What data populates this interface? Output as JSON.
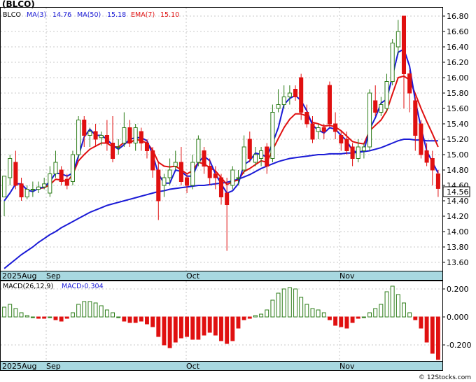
{
  "title": "(BLCO)",
  "legend": {
    "ticker": "BLCO",
    "ma3_label": "MA(3)",
    "ma3_value": "14.76",
    "ma50_label": "MA(50)",
    "ma50_value": "15.18",
    "ema7_label": "EMA(7)",
    "ema7_value": "15.10"
  },
  "macd_legend": {
    "label": "MACD(26,12,9)",
    "macd_label": "MACD:",
    "macd_value": "-0.304"
  },
  "last_price_tag": "14.56",
  "watermark": "© 12Stocks.com",
  "colors": {
    "up": "#2e7d1a",
    "down": "#e01010",
    "ma_blue": "#1a1ad6",
    "ema_red": "#e01010",
    "axis_band": "#a8d8e0",
    "grid": "#b8b8b8"
  },
  "chart_data": [
    {
      "type": "candlestick",
      "title": "(BLCO)",
      "x_tick_labels": [
        "2025Aug",
        "Sep",
        "Oct",
        "Nov"
      ],
      "y_tick_labels": [
        "13.60",
        "13.80",
        "14.00",
        "14.20",
        "14.40",
        "14.60",
        "14.80",
        "15.00",
        "15.20",
        "15.40",
        "15.60",
        "15.80",
        "16.00",
        "16.20",
        "16.40",
        "16.60",
        "16.80"
      ],
      "ylim": [
        13.5,
        16.9
      ],
      "grid": true,
      "candles": [
        [
          14.45,
          14.72,
          14.4,
          14.2
        ],
        [
          14.7,
          14.95,
          15.0,
          14.6
        ],
        [
          14.9,
          14.6,
          15.05,
          14.55
        ],
        [
          14.62,
          14.45,
          14.7,
          14.4
        ],
        [
          14.45,
          14.55,
          14.6,
          14.42
        ],
        [
          14.55,
          14.55,
          14.65,
          14.45
        ],
        [
          14.55,
          14.58,
          14.65,
          14.5
        ],
        [
          14.58,
          14.62,
          14.7,
          14.55
        ],
        [
          14.5,
          14.75,
          14.85,
          14.45
        ],
        [
          14.75,
          14.9,
          15.05,
          14.7
        ],
        [
          14.8,
          14.65,
          14.85,
          14.6
        ],
        [
          14.68,
          14.6,
          14.75,
          14.55
        ],
        [
          14.65,
          15.0,
          15.05,
          14.6
        ],
        [
          15.0,
          15.45,
          15.5,
          14.95
        ],
        [
          15.45,
          15.25,
          15.5,
          15.1
        ],
        [
          15.25,
          15.3,
          15.35,
          15.1
        ],
        [
          15.3,
          15.2,
          15.4,
          15.1
        ],
        [
          15.22,
          15.25,
          15.3,
          15.12
        ],
        [
          15.25,
          15.15,
          15.45,
          15.05
        ],
        [
          15.15,
          14.95,
          15.5,
          14.9
        ],
        [
          15.1,
          15.1,
          15.2,
          15.0
        ],
        [
          15.15,
          15.35,
          15.55,
          15.1
        ],
        [
          15.35,
          15.15,
          15.45,
          15.1
        ],
        [
          15.15,
          15.35,
          15.4,
          15.05
        ],
        [
          15.3,
          15.15,
          15.35,
          15.05
        ],
        [
          15.15,
          15.05,
          15.2,
          14.95
        ],
        [
          15.05,
          14.8,
          15.1,
          14.7
        ],
        [
          14.8,
          14.4,
          14.9,
          14.15
        ],
        [
          14.6,
          14.7,
          14.75,
          14.45
        ],
        [
          14.7,
          14.8,
          14.95,
          14.6
        ],
        [
          14.85,
          14.9,
          15.05,
          14.8
        ],
        [
          14.9,
          14.65,
          15.1,
          14.6
        ],
        [
          14.7,
          14.6,
          14.75,
          14.5
        ],
        [
          14.6,
          14.9,
          15.0,
          14.55
        ],
        [
          14.9,
          15.2,
          15.25,
          14.85
        ],
        [
          15.05,
          14.85,
          15.1,
          14.75
        ],
        [
          14.85,
          14.7,
          14.95,
          14.6
        ],
        [
          14.75,
          14.7,
          14.85,
          14.55
        ],
        [
          14.7,
          14.45,
          14.75,
          14.35
        ],
        [
          14.5,
          14.35,
          14.7,
          13.75
        ],
        [
          14.6,
          14.8,
          14.85,
          14.55
        ],
        [
          14.7,
          14.7,
          14.8,
          14.6
        ],
        [
          14.8,
          15.1,
          15.25,
          14.75
        ],
        [
          15.2,
          14.95,
          15.3,
          14.9
        ],
        [
          14.9,
          15.0,
          15.1,
          14.85
        ],
        [
          14.95,
          15.05,
          15.1,
          14.85
        ],
        [
          15.1,
          14.85,
          15.15,
          14.75
        ],
        [
          14.95,
          15.55,
          15.65,
          14.9
        ],
        [
          15.6,
          15.65,
          15.85,
          15.55
        ],
        [
          15.65,
          15.75,
          15.9,
          15.6
        ],
        [
          15.75,
          15.8,
          15.9,
          15.65
        ],
        [
          15.85,
          15.75,
          15.9,
          15.7
        ],
        [
          16.0,
          15.55,
          16.05,
          15.45
        ],
        [
          15.55,
          15.4,
          15.65,
          15.35
        ],
        [
          15.4,
          15.2,
          15.5,
          15.15
        ],
        [
          15.3,
          15.35,
          15.4,
          15.2
        ],
        [
          15.35,
          15.3,
          15.4,
          15.2
        ],
        [
          15.9,
          15.4,
          15.95,
          15.35
        ],
        [
          15.4,
          15.3,
          15.55,
          15.2
        ],
        [
          15.25,
          15.15,
          15.3,
          15.05
        ],
        [
          15.2,
          15.05,
          15.3,
          15.0
        ],
        [
          15.1,
          14.95,
          15.15,
          14.85
        ],
        [
          14.95,
          15.1,
          15.2,
          14.9
        ],
        [
          15.05,
          15.1,
          15.15,
          14.95
        ],
        [
          15.1,
          15.8,
          15.85,
          15.05
        ],
        [
          15.7,
          15.55,
          15.9,
          15.5
        ],
        [
          15.55,
          15.65,
          15.75,
          15.5
        ],
        [
          15.6,
          15.95,
          16.05,
          15.55
        ],
        [
          15.95,
          16.45,
          16.5,
          15.9
        ],
        [
          16.4,
          16.6,
          16.75,
          16.3
        ],
        [
          16.8,
          16.05,
          16.8,
          15.6
        ],
        [
          16.05,
          15.8,
          16.1,
          15.55
        ],
        [
          15.7,
          15.25,
          15.75,
          15.05
        ],
        [
          15.4,
          15.0,
          15.45,
          14.95
        ],
        [
          15.05,
          14.9,
          15.15,
          14.85
        ],
        [
          14.95,
          14.8,
          15.05,
          14.6
        ],
        [
          14.75,
          14.56,
          14.8,
          14.45
        ]
      ],
      "ma3": [
        14.4,
        14.5,
        14.62,
        14.62,
        14.54,
        14.52,
        14.56,
        14.58,
        14.65,
        14.76,
        14.75,
        14.72,
        14.76,
        14.98,
        15.23,
        15.33,
        15.25,
        15.25,
        15.2,
        15.12,
        15.07,
        15.13,
        15.2,
        15.22,
        15.22,
        15.18,
        15.0,
        14.75,
        14.63,
        14.63,
        14.8,
        14.78,
        14.72,
        14.72,
        14.9,
        14.98,
        14.92,
        14.75,
        14.62,
        14.5,
        14.53,
        14.62,
        14.87,
        14.92,
        15.02,
        15.0,
        14.97,
        15.15,
        15.35,
        15.65,
        15.73,
        15.77,
        15.7,
        15.57,
        15.38,
        15.32,
        15.28,
        15.35,
        15.33,
        15.25,
        15.18,
        15.05,
        15.03,
        15.05,
        15.33,
        15.48,
        15.67,
        15.72,
        16.02,
        16.33,
        16.37,
        16.15,
        15.7,
        15.35,
        15.05,
        14.9,
        14.76
      ],
      "ema7": [
        null,
        null,
        null,
        null,
        null,
        null,
        14.56,
        14.57,
        14.61,
        14.68,
        14.67,
        14.65,
        14.74,
        14.92,
        15.0,
        15.07,
        15.11,
        15.15,
        15.15,
        15.1,
        15.1,
        15.16,
        15.15,
        15.2,
        15.18,
        15.15,
        15.06,
        14.9,
        14.85,
        14.84,
        14.85,
        14.8,
        14.75,
        14.79,
        14.9,
        14.88,
        14.83,
        14.79,
        14.7,
        14.61,
        14.65,
        14.67,
        14.78,
        14.82,
        14.87,
        14.92,
        14.9,
        15.06,
        15.21,
        15.35,
        15.46,
        15.53,
        15.53,
        15.5,
        15.42,
        15.4,
        15.37,
        15.38,
        15.36,
        15.31,
        15.24,
        15.17,
        15.15,
        15.14,
        15.31,
        15.38,
        15.45,
        15.57,
        15.79,
        16.0,
        16.02,
        15.97,
        15.79,
        15.6,
        15.43,
        15.27,
        15.1
      ],
      "ma50": [
        13.52,
        13.58,
        13.64,
        13.7,
        13.75,
        13.8,
        13.86,
        13.91,
        13.96,
        14.0,
        14.05,
        14.09,
        14.13,
        14.17,
        14.21,
        14.25,
        14.28,
        14.31,
        14.34,
        14.36,
        14.38,
        14.4,
        14.42,
        14.44,
        14.46,
        14.48,
        14.5,
        14.52,
        14.53,
        14.55,
        14.56,
        14.57,
        14.58,
        14.59,
        14.6,
        14.6,
        14.61,
        14.62,
        14.63,
        14.64,
        14.66,
        14.68,
        14.71,
        14.74,
        14.78,
        14.82,
        14.85,
        14.88,
        14.91,
        14.93,
        14.95,
        14.96,
        14.97,
        14.98,
        14.99,
        15.0,
        15.0,
        15.01,
        15.01,
        15.01,
        15.02,
        15.02,
        15.03,
        15.04,
        15.05,
        15.07,
        15.09,
        15.12,
        15.15,
        15.18,
        15.2,
        15.2,
        15.19,
        15.19,
        15.18,
        15.18,
        15.18
      ]
    },
    {
      "type": "bar",
      "title": "MACD(26,12,9)",
      "x_tick_labels": [
        "2025Aug",
        "Sep",
        "Oct",
        "Nov"
      ],
      "y_tick_labels": [
        "0.200",
        "0.000",
        "-0.200"
      ],
      "ylim": [
        -0.31,
        0.25
      ],
      "grid": true,
      "values": [
        0.07,
        0.09,
        0.06,
        0.03,
        0.01,
        0.0,
        -0.01,
        -0.01,
        0.0,
        -0.02,
        -0.03,
        -0.01,
        0.03,
        0.09,
        0.11,
        0.11,
        0.1,
        0.08,
        0.05,
        0.03,
        0.0,
        -0.03,
        -0.04,
        -0.04,
        -0.03,
        -0.05,
        -0.07,
        -0.14,
        -0.2,
        -0.22,
        -0.18,
        -0.15,
        -0.14,
        -0.16,
        -0.16,
        -0.13,
        -0.11,
        -0.13,
        -0.17,
        -0.19,
        -0.17,
        -0.08,
        -0.02,
        -0.01,
        0.01,
        0.02,
        0.05,
        0.12,
        0.17,
        0.2,
        0.21,
        0.2,
        0.14,
        0.09,
        0.06,
        0.05,
        0.03,
        -0.02,
        -0.06,
        -0.07,
        -0.08,
        -0.04,
        -0.01,
        0.0,
        0.03,
        0.06,
        0.09,
        0.18,
        0.22,
        0.16,
        0.1,
        0.03,
        -0.02,
        -0.08,
        -0.18,
        -0.26,
        -0.304
      ]
    }
  ]
}
